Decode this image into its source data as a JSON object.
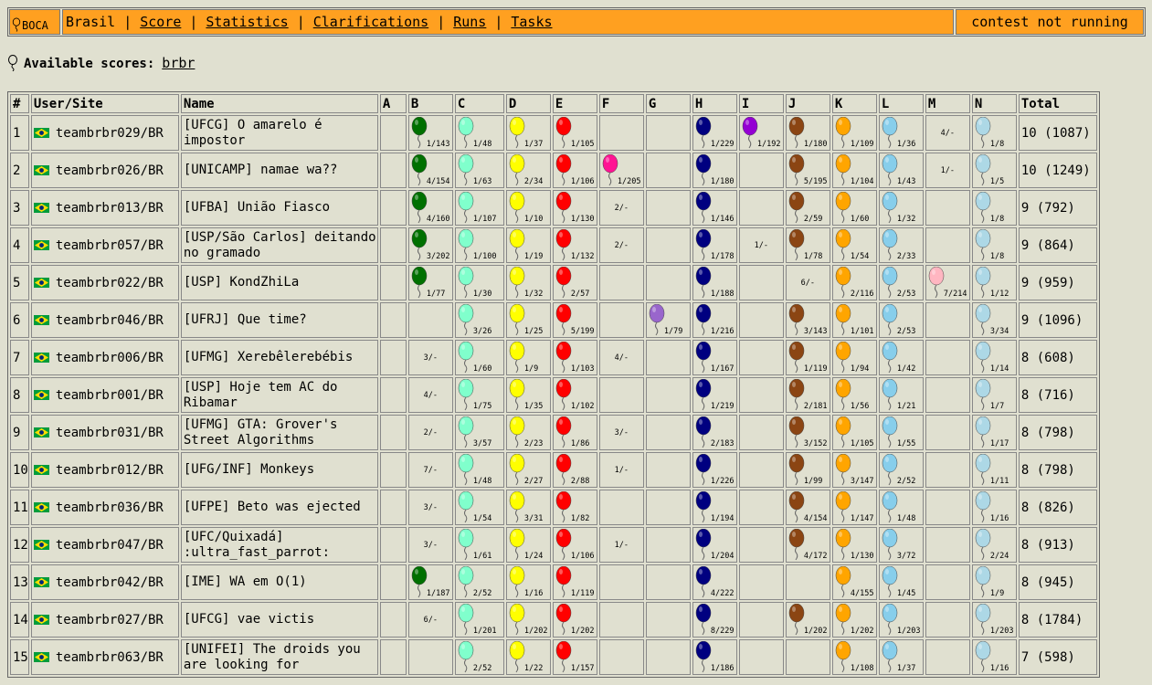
{
  "header": {
    "logo": "BOCA",
    "site": "Brasil",
    "nav": [
      "Score",
      "Statistics",
      "Clarifications",
      "Runs",
      "Tasks"
    ],
    "status": "contest not running"
  },
  "available": {
    "label": "Available scores:",
    "link": "brbr"
  },
  "columns": [
    "#",
    "User/Site",
    "Name",
    "A",
    "B",
    "C",
    "D",
    "E",
    "F",
    "G",
    "H",
    "I",
    "J",
    "K",
    "L",
    "M",
    "N",
    "Total"
  ],
  "colors": {
    "B": "#007000",
    "C": "#80ffcc",
    "D": "#ffff00",
    "E": "#ff0000",
    "F": "#ff1493",
    "G": "#9966cc",
    "H": "#000080",
    "I": "#9400d3",
    "J": "#8b4513",
    "K": "#ffa500",
    "L": "#87ceeb",
    "M": "#ffb6c1",
    "N": "#add8e6",
    "accent": "#ffa020",
    "background": "#e0e0d0"
  },
  "rows": [
    {
      "rank": "1",
      "user": "teambrbr029/BR",
      "name": "[UFCG] O amarelo é impostor",
      "total": "10 (1087)",
      "cells": [
        null,
        {
          "s": true,
          "t": "1/143"
        },
        {
          "s": true,
          "t": "1/48"
        },
        {
          "s": true,
          "t": "1/37"
        },
        {
          "s": true,
          "t": "1/105"
        },
        null,
        null,
        {
          "s": true,
          "t": "1/229"
        },
        {
          "s": true,
          "t": "1/192"
        },
        {
          "s": true,
          "t": "1/180"
        },
        {
          "s": true,
          "t": "1/109"
        },
        {
          "s": true,
          "t": "1/36"
        },
        {
          "s": false,
          "t": "4/-"
        },
        {
          "s": true,
          "t": "1/8"
        }
      ]
    },
    {
      "rank": "2",
      "user": "teambrbr026/BR",
      "name": "[UNICAMP] namae wa??",
      "total": "10 (1249)",
      "cells": [
        null,
        {
          "s": true,
          "t": "4/154"
        },
        {
          "s": true,
          "t": "1/63"
        },
        {
          "s": true,
          "t": "2/34"
        },
        {
          "s": true,
          "t": "1/106"
        },
        {
          "s": true,
          "t": "1/205"
        },
        null,
        {
          "s": true,
          "t": "1/180"
        },
        null,
        {
          "s": true,
          "t": "5/195"
        },
        {
          "s": true,
          "t": "1/104"
        },
        {
          "s": true,
          "t": "1/43"
        },
        {
          "s": false,
          "t": "1/-"
        },
        {
          "s": true,
          "t": "1/5"
        }
      ]
    },
    {
      "rank": "3",
      "user": "teambrbr013/BR",
      "name": "[UFBA] União Fiasco",
      "total": "9 (792)",
      "cells": [
        null,
        {
          "s": true,
          "t": "4/160"
        },
        {
          "s": true,
          "t": "1/107"
        },
        {
          "s": true,
          "t": "1/10"
        },
        {
          "s": true,
          "t": "1/130"
        },
        {
          "s": false,
          "t": "2/-"
        },
        null,
        {
          "s": true,
          "t": "1/146"
        },
        null,
        {
          "s": true,
          "t": "2/59"
        },
        {
          "s": true,
          "t": "1/60"
        },
        {
          "s": true,
          "t": "1/32"
        },
        null,
        {
          "s": true,
          "t": "1/8"
        }
      ]
    },
    {
      "rank": "4",
      "user": "teambrbr057/BR",
      "name": "[USP/São Carlos] deitando no gramado",
      "total": "9 (864)",
      "cells": [
        null,
        {
          "s": true,
          "t": "3/202"
        },
        {
          "s": true,
          "t": "1/100"
        },
        {
          "s": true,
          "t": "1/19"
        },
        {
          "s": true,
          "t": "1/132"
        },
        {
          "s": false,
          "t": "2/-"
        },
        null,
        {
          "s": true,
          "t": "1/178"
        },
        {
          "s": false,
          "t": "1/-"
        },
        {
          "s": true,
          "t": "1/78"
        },
        {
          "s": true,
          "t": "1/54"
        },
        {
          "s": true,
          "t": "2/33"
        },
        null,
        {
          "s": true,
          "t": "1/8"
        }
      ]
    },
    {
      "rank": "5",
      "user": "teambrbr022/BR",
      "name": "[USP] KondZhiLa",
      "total": "9 (959)",
      "cells": [
        null,
        {
          "s": true,
          "t": "1/77"
        },
        {
          "s": true,
          "t": "1/30"
        },
        {
          "s": true,
          "t": "1/32"
        },
        {
          "s": true,
          "t": "2/57"
        },
        null,
        null,
        {
          "s": true,
          "t": "1/188"
        },
        null,
        {
          "s": false,
          "t": "6/-"
        },
        {
          "s": true,
          "t": "2/116"
        },
        {
          "s": true,
          "t": "2/53"
        },
        {
          "s": true,
          "t": "7/214"
        },
        {
          "s": true,
          "t": "1/12"
        }
      ]
    },
    {
      "rank": "6",
      "user": "teambrbr046/BR",
      "name": "[UFRJ] Que time?",
      "total": "9 (1096)",
      "cells": [
        null,
        null,
        {
          "s": true,
          "t": "3/26"
        },
        {
          "s": true,
          "t": "1/25"
        },
        {
          "s": true,
          "t": "5/199"
        },
        null,
        {
          "s": true,
          "t": "1/79"
        },
        {
          "s": true,
          "t": "1/216"
        },
        null,
        {
          "s": true,
          "t": "3/143"
        },
        {
          "s": true,
          "t": "1/101"
        },
        {
          "s": true,
          "t": "2/53"
        },
        null,
        {
          "s": true,
          "t": "3/34"
        }
      ]
    },
    {
      "rank": "7",
      "user": "teambrbr006/BR",
      "name": "[UFMG] Xerebêlerebébis",
      "total": "8 (608)",
      "cells": [
        null,
        {
          "s": false,
          "t": "3/-"
        },
        {
          "s": true,
          "t": "1/60"
        },
        {
          "s": true,
          "t": "1/9"
        },
        {
          "s": true,
          "t": "1/103"
        },
        {
          "s": false,
          "t": "4/-"
        },
        null,
        {
          "s": true,
          "t": "1/167"
        },
        null,
        {
          "s": true,
          "t": "1/119"
        },
        {
          "s": true,
          "t": "1/94"
        },
        {
          "s": true,
          "t": "1/42"
        },
        null,
        {
          "s": true,
          "t": "1/14"
        }
      ]
    },
    {
      "rank": "8",
      "user": "teambrbr001/BR",
      "name": "[USP] Hoje tem AC do Ribamar",
      "total": "8 (716)",
      "cells": [
        null,
        {
          "s": false,
          "t": "4/-"
        },
        {
          "s": true,
          "t": "1/75"
        },
        {
          "s": true,
          "t": "1/35"
        },
        {
          "s": true,
          "t": "1/102"
        },
        null,
        null,
        {
          "s": true,
          "t": "1/219"
        },
        null,
        {
          "s": true,
          "t": "2/181"
        },
        {
          "s": true,
          "t": "1/56"
        },
        {
          "s": true,
          "t": "1/21"
        },
        null,
        {
          "s": true,
          "t": "1/7"
        }
      ]
    },
    {
      "rank": "9",
      "user": "teambrbr031/BR",
      "name": "[UFMG] GTA: Grover's Street Algorithms",
      "total": "8 (798)",
      "cells": [
        null,
        {
          "s": false,
          "t": "2/-"
        },
        {
          "s": true,
          "t": "3/57"
        },
        {
          "s": true,
          "t": "2/23"
        },
        {
          "s": true,
          "t": "1/86"
        },
        {
          "s": false,
          "t": "3/-"
        },
        null,
        {
          "s": true,
          "t": "2/183"
        },
        null,
        {
          "s": true,
          "t": "3/152"
        },
        {
          "s": true,
          "t": "1/105"
        },
        {
          "s": true,
          "t": "1/55"
        },
        null,
        {
          "s": true,
          "t": "1/17"
        }
      ]
    },
    {
      "rank": "10",
      "user": "teambrbr012/BR",
      "name": "[UFG/INF] Monkeys",
      "total": "8 (798)",
      "cells": [
        null,
        {
          "s": false,
          "t": "7/-"
        },
        {
          "s": true,
          "t": "1/48"
        },
        {
          "s": true,
          "t": "2/27"
        },
        {
          "s": true,
          "t": "2/88"
        },
        {
          "s": false,
          "t": "1/-"
        },
        null,
        {
          "s": true,
          "t": "1/226"
        },
        null,
        {
          "s": true,
          "t": "1/99"
        },
        {
          "s": true,
          "t": "3/147"
        },
        {
          "s": true,
          "t": "2/52"
        },
        null,
        {
          "s": true,
          "t": "1/11"
        }
      ]
    },
    {
      "rank": "11",
      "user": "teambrbr036/BR",
      "name": "[UFPE] Beto was ejected",
      "total": "8 (826)",
      "cells": [
        null,
        {
          "s": false,
          "t": "3/-"
        },
        {
          "s": true,
          "t": "1/54"
        },
        {
          "s": true,
          "t": "3/31"
        },
        {
          "s": true,
          "t": "1/82"
        },
        null,
        null,
        {
          "s": true,
          "t": "1/194"
        },
        null,
        {
          "s": true,
          "t": "4/154"
        },
        {
          "s": true,
          "t": "1/147"
        },
        {
          "s": true,
          "t": "1/48"
        },
        null,
        {
          "s": true,
          "t": "1/16"
        }
      ]
    },
    {
      "rank": "12",
      "user": "teambrbr047/BR",
      "name": "[UFC/Quixadá] :ultra_fast_parrot:",
      "total": "8 (913)",
      "cells": [
        null,
        {
          "s": false,
          "t": "3/-"
        },
        {
          "s": true,
          "t": "1/61"
        },
        {
          "s": true,
          "t": "1/24"
        },
        {
          "s": true,
          "t": "1/106"
        },
        {
          "s": false,
          "t": "1/-"
        },
        null,
        {
          "s": true,
          "t": "1/204"
        },
        null,
        {
          "s": true,
          "t": "4/172"
        },
        {
          "s": true,
          "t": "1/130"
        },
        {
          "s": true,
          "t": "3/72"
        },
        null,
        {
          "s": true,
          "t": "2/24"
        }
      ]
    },
    {
      "rank": "13",
      "user": "teambrbr042/BR",
      "name": "[IME] WA em O(1)",
      "total": "8 (945)",
      "cells": [
        null,
        {
          "s": true,
          "t": "1/187"
        },
        {
          "s": true,
          "t": "2/52"
        },
        {
          "s": true,
          "t": "1/16"
        },
        {
          "s": true,
          "t": "1/119"
        },
        null,
        null,
        {
          "s": true,
          "t": "4/222"
        },
        null,
        null,
        {
          "s": true,
          "t": "4/155"
        },
        {
          "s": true,
          "t": "1/45"
        },
        null,
        {
          "s": true,
          "t": "1/9"
        }
      ]
    },
    {
      "rank": "14",
      "user": "teambrbr027/BR",
      "name": "[UFCG] vae victis",
      "total": "8 (1784)",
      "cells": [
        null,
        {
          "s": false,
          "t": "6/-"
        },
        {
          "s": true,
          "t": "1/201"
        },
        {
          "s": true,
          "t": "1/202"
        },
        {
          "s": true,
          "t": "1/202"
        },
        null,
        null,
        {
          "s": true,
          "t": "8/229"
        },
        null,
        {
          "s": true,
          "t": "1/202"
        },
        {
          "s": true,
          "t": "1/202"
        },
        {
          "s": true,
          "t": "1/203"
        },
        null,
        {
          "s": true,
          "t": "1/203"
        }
      ]
    },
    {
      "rank": "15",
      "user": "teambrbr063/BR",
      "name": "[UNIFEI] The droids you are looking for",
      "total": "7 (598)",
      "cells": [
        null,
        null,
        {
          "s": true,
          "t": "2/52"
        },
        {
          "s": true,
          "t": "1/22"
        },
        {
          "s": true,
          "t": "1/157"
        },
        null,
        null,
        {
          "s": true,
          "t": "1/186"
        },
        null,
        null,
        {
          "s": true,
          "t": "1/108"
        },
        {
          "s": true,
          "t": "1/37"
        },
        null,
        {
          "s": true,
          "t": "1/16"
        }
      ]
    }
  ]
}
